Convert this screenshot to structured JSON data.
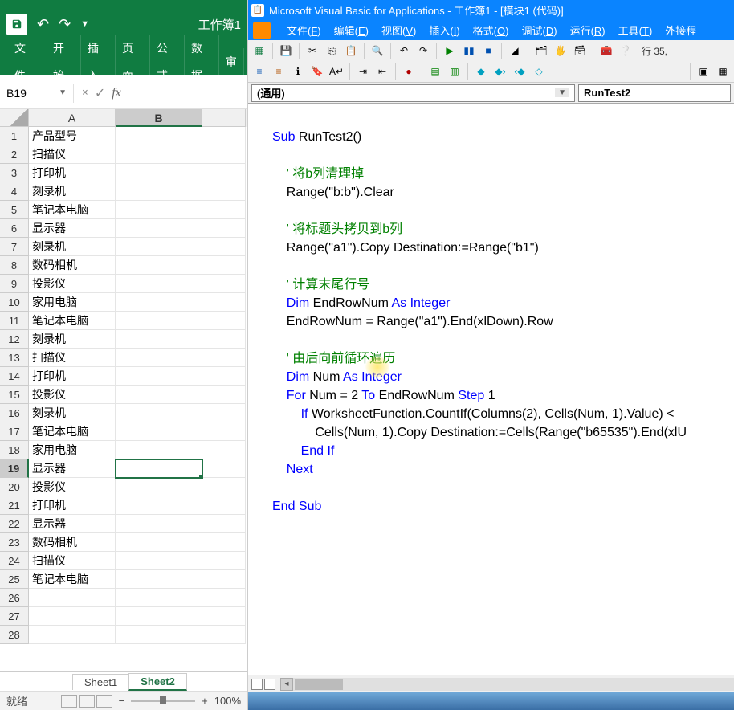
{
  "excel": {
    "title": "工作簿1",
    "ribbon": [
      "文件",
      "开始",
      "插入",
      "页面",
      "公式",
      "数据",
      "审"
    ],
    "name_box": "B19",
    "columns": [
      "A",
      "B",
      ""
    ],
    "rows": [
      {
        "n": "1",
        "a": "产品型号",
        "b": ""
      },
      {
        "n": "2",
        "a": "扫描仪",
        "b": ""
      },
      {
        "n": "3",
        "a": "打印机",
        "b": ""
      },
      {
        "n": "4",
        "a": "刻录机",
        "b": ""
      },
      {
        "n": "5",
        "a": "笔记本电脑",
        "b": ""
      },
      {
        "n": "6",
        "a": "显示器",
        "b": ""
      },
      {
        "n": "7",
        "a": "刻录机",
        "b": ""
      },
      {
        "n": "8",
        "a": "数码相机",
        "b": ""
      },
      {
        "n": "9",
        "a": "投影仪",
        "b": ""
      },
      {
        "n": "10",
        "a": "家用电脑",
        "b": ""
      },
      {
        "n": "11",
        "a": "笔记本电脑",
        "b": ""
      },
      {
        "n": "12",
        "a": "刻录机",
        "b": ""
      },
      {
        "n": "13",
        "a": "扫描仪",
        "b": ""
      },
      {
        "n": "14",
        "a": "打印机",
        "b": ""
      },
      {
        "n": "15",
        "a": "投影仪",
        "b": ""
      },
      {
        "n": "16",
        "a": "刻录机",
        "b": ""
      },
      {
        "n": "17",
        "a": "笔记本电脑",
        "b": ""
      },
      {
        "n": "18",
        "a": "家用电脑",
        "b": ""
      },
      {
        "n": "19",
        "a": "显示器",
        "b": ""
      },
      {
        "n": "20",
        "a": "投影仪",
        "b": ""
      },
      {
        "n": "21",
        "a": "打印机",
        "b": ""
      },
      {
        "n": "22",
        "a": "显示器",
        "b": ""
      },
      {
        "n": "23",
        "a": "数码相机",
        "b": ""
      },
      {
        "n": "24",
        "a": "扫描仪",
        "b": ""
      },
      {
        "n": "25",
        "a": "笔记本电脑",
        "b": ""
      },
      {
        "n": "26",
        "a": "",
        "b": ""
      },
      {
        "n": "27",
        "a": "",
        "b": ""
      },
      {
        "n": "28",
        "a": "",
        "b": ""
      }
    ],
    "active_row": 19,
    "sheets": [
      "Sheet1",
      "Sheet2"
    ],
    "active_sheet": 1,
    "status": "就绪",
    "zoom": "100%"
  },
  "vba": {
    "title": "Microsoft Visual Basic for Applications - 工作簿1 - [模块1 (代码)]",
    "menus": [
      {
        "l": "文件",
        "k": "F"
      },
      {
        "l": "编辑",
        "k": "E"
      },
      {
        "l": "视图",
        "k": "V"
      },
      {
        "l": "插入",
        "k": "I"
      },
      {
        "l": "格式",
        "k": "O"
      },
      {
        "l": "调试",
        "k": "D"
      },
      {
        "l": "运行",
        "k": "R"
      },
      {
        "l": "工具",
        "k": "T"
      },
      {
        "l": "外接程",
        "k": ""
      }
    ],
    "line_info": "行 35,",
    "object_dd": "(通用)",
    "proc_dd": "RunTest2",
    "code": {
      "sub_open": {
        "kw": "Sub",
        "name": " RunTest2()"
      },
      "c1": "    ' 将b列清理掉",
      "l1": "    Range(\"b:b\").Clear",
      "c2": "    ' 将标题头拷贝到b列",
      "l2": "    Range(\"a1\").Copy Destination:=Range(\"b1\")",
      "c3": "    ' 计算末尾行号",
      "l3a": "Dim",
      "l3b": " EndRowNum ",
      "l3c": "As Integer",
      "l4": "    EndRowNum = Range(\"a1\").End(xlDown).Row",
      "c4": "    ' 由后向前循环遍历",
      "l5a": "Dim",
      "l5b": " Num ",
      "l5c": "As Integer",
      "l6a": "For",
      "l6b": " Num = 2 ",
      "l6c": "To",
      "l6d": " EndRowNum ",
      "l6e": "Step",
      "l6f": " 1",
      "l7a": "If",
      "l7b": " WorksheetFunction.CountIf(Columns(2), Cells(Num, 1).Value) < ",
      "l8": "            Cells(Num, 1).Copy Destination:=Cells(Range(\"b65535\").End(xlU",
      "l9": "End If",
      "l10": "Next",
      "sub_close": "End Sub"
    }
  }
}
